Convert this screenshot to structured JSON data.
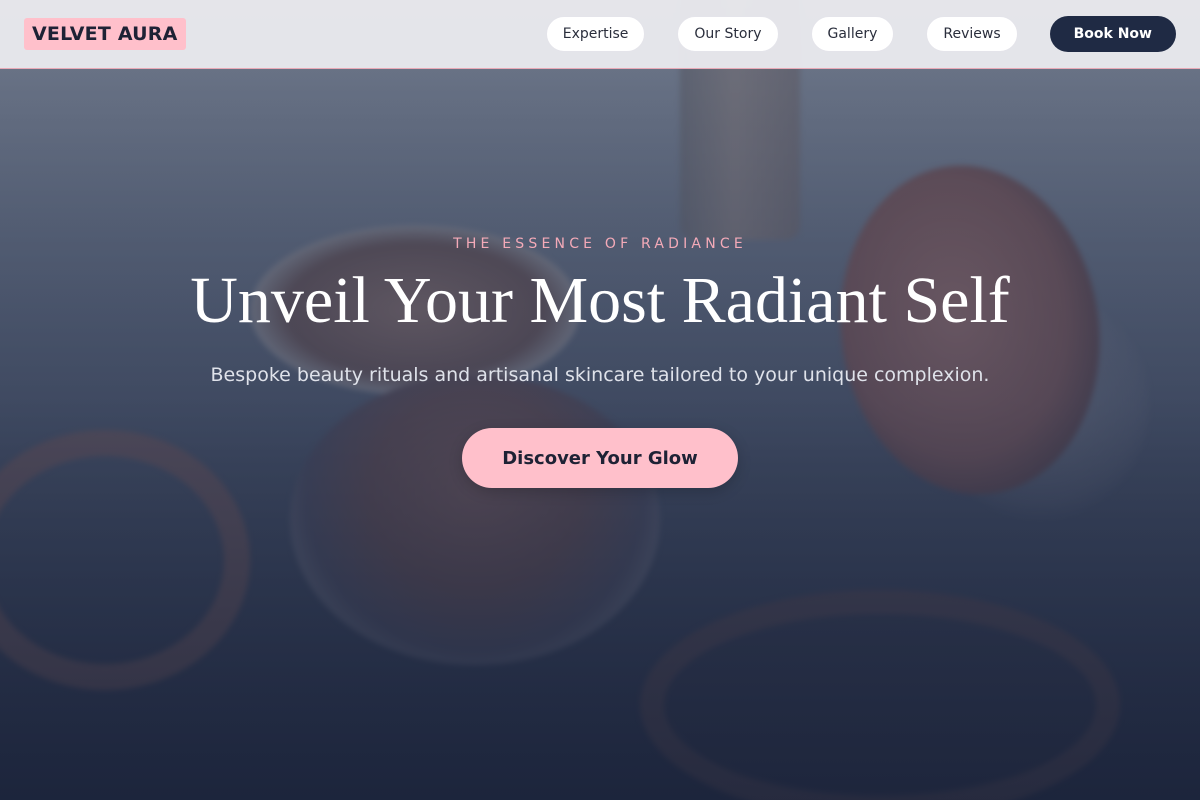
{
  "brand": {
    "name": "VELVET AURA"
  },
  "nav": {
    "links": [
      {
        "label": "Expertise"
      },
      {
        "label": "Our Story"
      },
      {
        "label": "Gallery"
      },
      {
        "label": "Reviews"
      }
    ],
    "cta_label": "Book Now"
  },
  "hero": {
    "eyebrow": "THE ESSENCE OF RADIANCE",
    "headline": "Unveil Your Most Radiant Self",
    "subheadline": "Bespoke beauty rituals and artisanal skincare tailored to your unique complexion.",
    "cta_label": "Discover Your Glow",
    "background_image": "blurred-cosmetic-jars"
  },
  "colors": {
    "accent_pink": "#ffc0cb",
    "eyebrow_pink": "#f4aab8",
    "navy": "#1f2a44",
    "header_bg": "#ececf0"
  }
}
